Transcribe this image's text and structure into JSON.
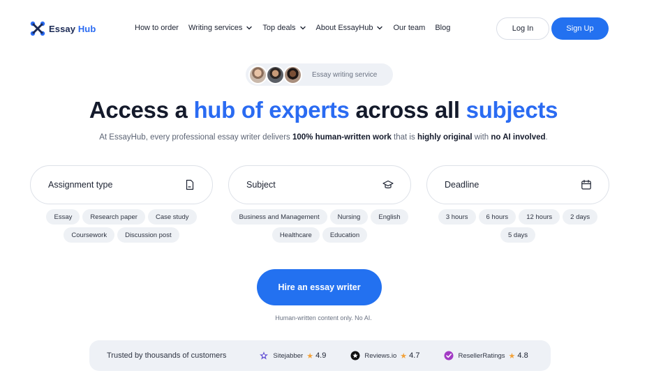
{
  "header": {
    "logo_word1": "Essay",
    "logo_word2": "Hub",
    "nav": [
      {
        "label": "How to order",
        "dropdown": false
      },
      {
        "label": "Writing services",
        "dropdown": true
      },
      {
        "label": "Top deals",
        "dropdown": true
      },
      {
        "label": "About EssayHub",
        "dropdown": true
      },
      {
        "label": "Our team",
        "dropdown": false
      },
      {
        "label": "Blog",
        "dropdown": false
      }
    ],
    "login_label": "Log In",
    "signup_label": "Sign Up"
  },
  "badge": {
    "text": "Essay writing service"
  },
  "hero": {
    "title_part1": "Access a ",
    "title_hl1": "hub of experts",
    "title_part2": " across all ",
    "title_hl2": "subjects",
    "sub_part1": "At EssayHub, every professional essay writer delivers ",
    "sub_bold1": "100% human-written work",
    "sub_part2": " that is ",
    "sub_bold2": "highly original",
    "sub_part3": " with ",
    "sub_bold3": "no AI involved",
    "sub_part4": "."
  },
  "selectors": [
    {
      "label": "Assignment type",
      "icon": "document-icon",
      "chips": [
        "Essay",
        "Research paper",
        "Case study",
        "Coursework",
        "Discussion post"
      ]
    },
    {
      "label": "Subject",
      "icon": "graduation-cap-icon",
      "chips": [
        "Business and Management",
        "Nursing",
        "English",
        "Healthcare",
        "Education"
      ]
    },
    {
      "label": "Deadline",
      "icon": "calendar-icon",
      "chips": [
        "3 hours",
        "6 hours",
        "12 hours",
        "2 days",
        "5 days"
      ]
    }
  ],
  "cta": {
    "label": "Hire an essay writer",
    "note": "Human-written content only. No AI."
  },
  "trust": {
    "title": "Trusted by thousands of customers",
    "reviews": [
      {
        "name": "Sitejabber",
        "rating": "4.9",
        "icon": "sitejabber-icon"
      },
      {
        "name": "Reviews.io",
        "rating": "4.7",
        "icon": "reviews-io-icon"
      },
      {
        "name": "ResellerRatings",
        "rating": "4.8",
        "icon": "resellerratings-icon"
      }
    ]
  },
  "colors": {
    "accent": "#2371f0",
    "highlight_text": "#2a6bf2",
    "star": "#f2a23a",
    "chip_bg": "#eef1f5"
  }
}
